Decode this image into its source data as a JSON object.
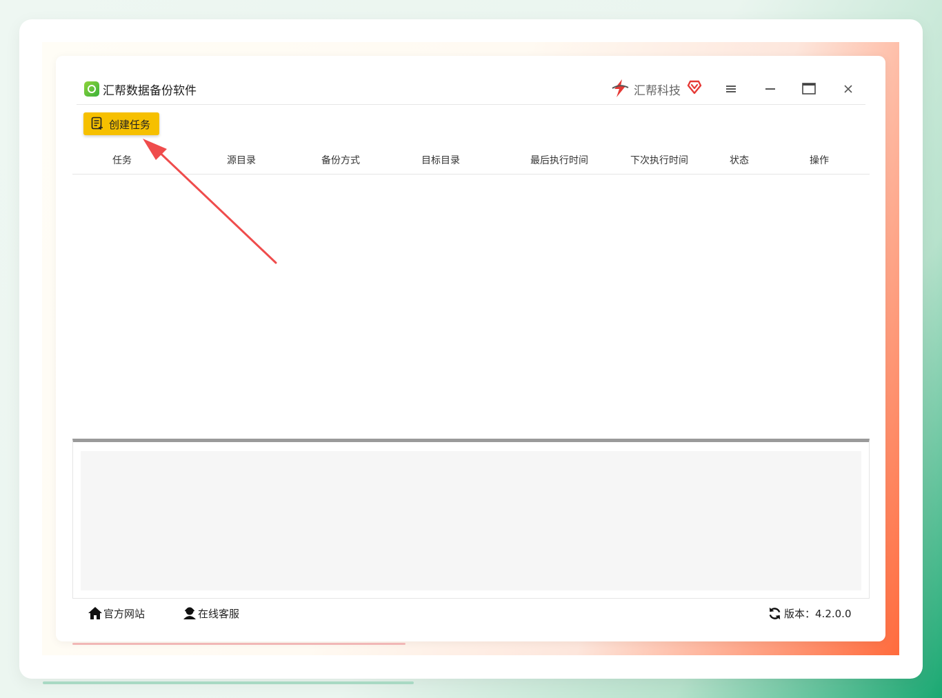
{
  "window": {
    "title": "汇帮数据备份软件",
    "brand": "汇帮科技",
    "controls": [
      "menu-icon",
      "minimize-icon",
      "maximize-icon",
      "close-icon"
    ]
  },
  "toolbar": {
    "create_task_label": "创建任务",
    "create_task_icon": "task-list-icon",
    "button_color": "#f6c000"
  },
  "table": {
    "columns": [
      "任务",
      "源目录",
      "备份方式",
      "目标目录",
      "最后执行时间",
      "下次执行时间",
      "状态",
      "操作"
    ],
    "rows": []
  },
  "log": {
    "content": ""
  },
  "footer": {
    "website_label": "官方网站",
    "website_icon": "home-icon",
    "service_label": "在线客服",
    "service_icon": "user-service-icon",
    "version_label": "版本：",
    "version_value": "4.2.0.0",
    "version_icon": "refresh-icon"
  },
  "colors": {
    "accent": "#f6c000",
    "annotation_arrow": "#ef4c4c",
    "brand_red": "#e53935",
    "app_icon_green": "#3bb23a"
  }
}
